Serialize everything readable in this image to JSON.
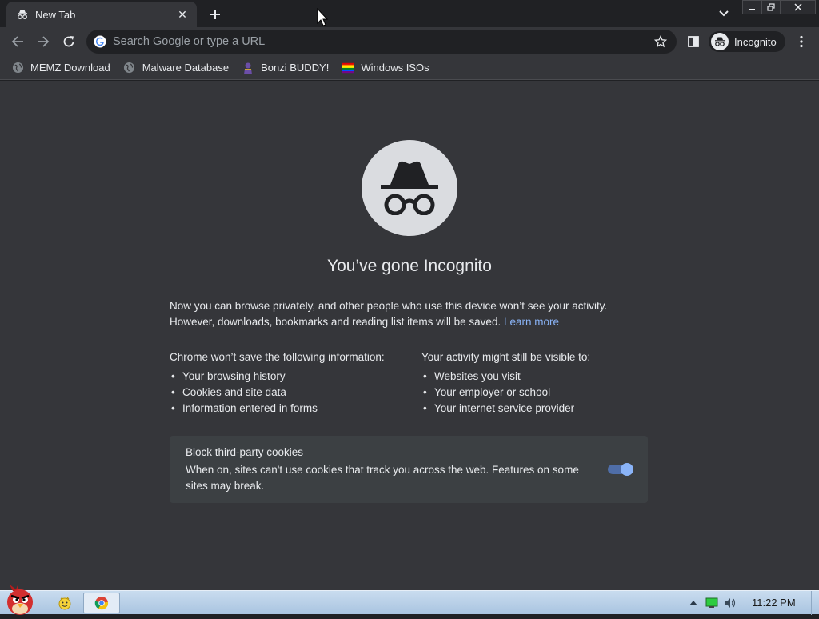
{
  "tab": {
    "title": "New Tab",
    "close": "✕"
  },
  "omnibox": {
    "placeholder": "Search Google or type a URL"
  },
  "profile": {
    "label": "Incognito"
  },
  "bookmarks": [
    {
      "label": "MEMZ Download",
      "icon": "globe-icon"
    },
    {
      "label": "Malware Database",
      "icon": "globe-icon"
    },
    {
      "label": "Bonzi BUDDY!",
      "icon": "bonzi-icon"
    },
    {
      "label": "Windows ISOs",
      "icon": "rainbow-flag-icon"
    }
  ],
  "page": {
    "heading": "You’ve gone Incognito",
    "intro_line1": "Now you can browse privately, and other people who use this device won’t see your activity.",
    "intro_line2": "However, downloads, bookmarks and reading list items will be saved.",
    "learn_more": "Learn more",
    "left_col": {
      "title": "Chrome won’t save the following information:",
      "items": [
        "Your browsing history",
        "Cookies and site data",
        "Information entered in forms"
      ]
    },
    "right_col": {
      "title": "Your activity might still be visible to:",
      "items": [
        "Websites you visit",
        "Your employer or school",
        "Your internet service provider"
      ]
    },
    "cookies": {
      "title": "Block third-party cookies",
      "description": "When on, sites can't use cookies that track you across the web. Features on some sites may break.",
      "enabled": true
    }
  },
  "taskbar": {
    "clock": "11:22 PM"
  },
  "colors": {
    "accent": "#8ab4f8",
    "page_bg": "#35363a",
    "frame_bg": "#202124"
  }
}
